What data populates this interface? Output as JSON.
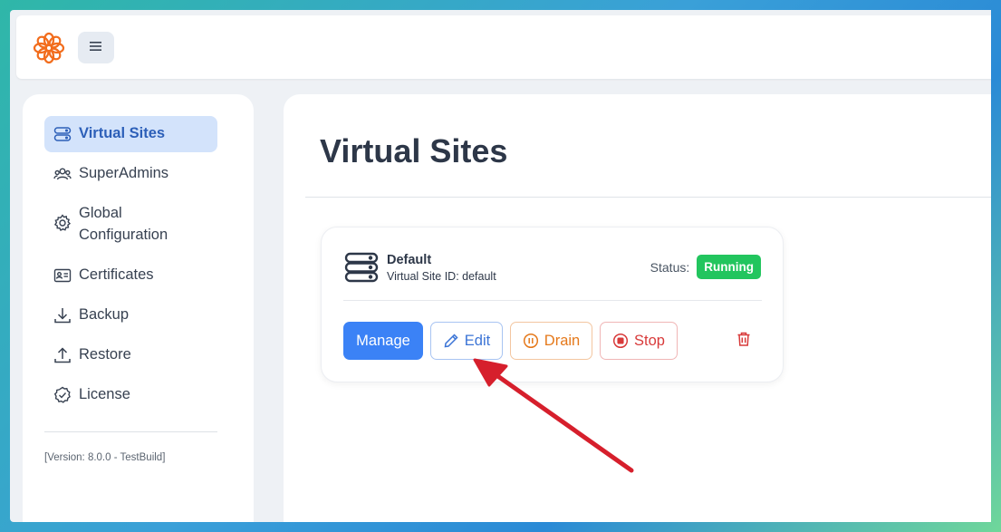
{
  "header": {
    "logo_icon": "flower-logo-icon",
    "menu_icon": "hamburger-menu-icon"
  },
  "sidebar": {
    "items": [
      {
        "label": "Virtual Sites",
        "icon": "server-stack-icon",
        "active": true
      },
      {
        "label": "SuperAdmins",
        "icon": "user-group-icon",
        "active": false
      },
      {
        "label": "Global Configuration",
        "icon": "gear-icon",
        "active": false
      },
      {
        "label": "Certificates",
        "icon": "id-card-icon",
        "active": false
      },
      {
        "label": "Backup",
        "icon": "download-icon",
        "active": false
      },
      {
        "label": "Restore",
        "icon": "upload-icon",
        "active": false
      },
      {
        "label": "License",
        "icon": "check-badge-icon",
        "active": false
      }
    ],
    "version": "[Version: 8.0.0 - TestBuild]"
  },
  "main": {
    "title": "Virtual Sites",
    "sites": [
      {
        "name": "Default",
        "id_label": "Virtual Site ID:",
        "id_value": "default",
        "status_label": "Status:",
        "status": "Running",
        "buttons": {
          "manage": "Manage",
          "edit": "Edit",
          "drain": "Drain",
          "stop": "Stop"
        }
      }
    ]
  },
  "colors": {
    "accent": "#3b82f6",
    "status_running": "#22c55e",
    "drain": "#e5791b",
    "stop": "#d83a3a",
    "annotation_arrow": "#d61f2c"
  }
}
